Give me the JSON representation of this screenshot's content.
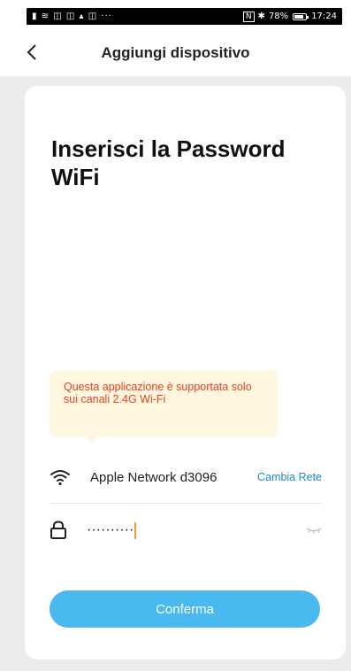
{
  "status_bar": {
    "left_icons": "⁠▮ ≋ ◫ ◫ ▴ ◫ ···",
    "nfc_label": "N",
    "battery_percent": "78%",
    "time": "17:24"
  },
  "header": {
    "back_icon": "chevron-left-icon",
    "title": "Aggiungi dispositivo"
  },
  "page": {
    "title": "Inserisci la Password WiFi"
  },
  "tooltip": {
    "text": "Questa applicazione è supportata solo sui canali 2.4G Wi-Fi"
  },
  "network": {
    "icon": "wifi-icon",
    "name": "Apple Network d3096",
    "change_label": "Cambia Rete"
  },
  "password": {
    "icon": "lock-icon",
    "value": "··········",
    "toggle_icon": "eye-closed-icon"
  },
  "confirm": {
    "label": "Conferma"
  },
  "colors": {
    "accent": "#4ab9f0",
    "link": "#1e87c8",
    "tooltip_bg": "#fff6e0",
    "tooltip_text": "#e0451f",
    "background": "#ececec"
  }
}
